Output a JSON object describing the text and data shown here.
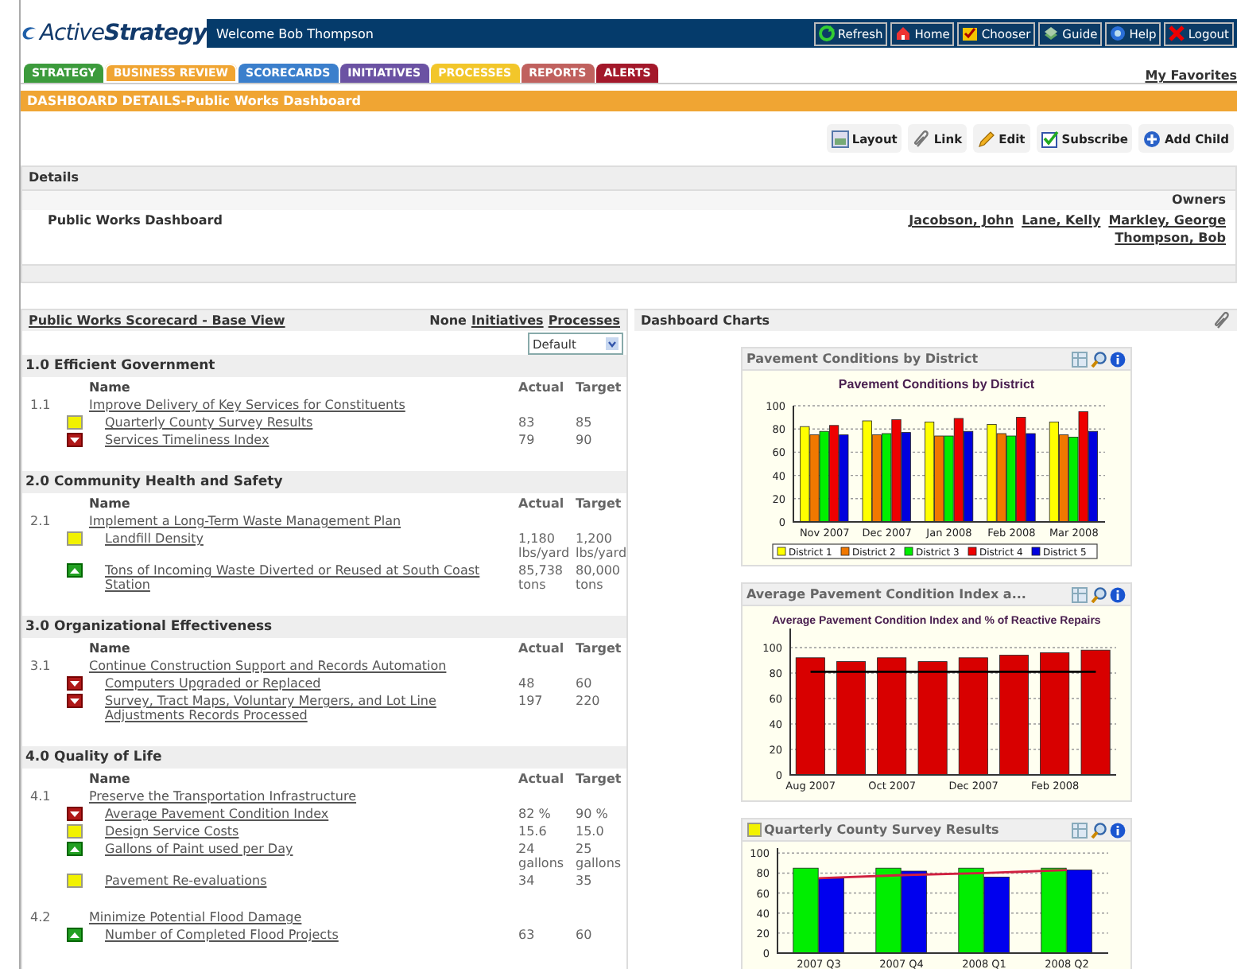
{
  "header": {
    "logo": "Active**Strategy**",
    "welcome": "Welcome Bob Thompson",
    "buttons": [
      "Refresh",
      "Home",
      "Chooser",
      "Guide",
      "Help",
      "Logout"
    ]
  },
  "tabs": [
    {
      "label": "STRATEGY",
      "color": "#3c9b3c",
      "selected": false
    },
    {
      "label": "BUSINESS REVIEW",
      "color": "#f0a533",
      "selected": true
    },
    {
      "label": "SCORECARDS",
      "color": "#3b7fcc",
      "selected": false
    },
    {
      "label": "INITIATIVES",
      "color": "#6b52a3",
      "selected": false
    },
    {
      "label": "PROCESSES",
      "color": "#f2c62a",
      "selected": false
    },
    {
      "label": "REPORTS",
      "color": "#c0615e",
      "selected": false
    },
    {
      "label": "ALERTS",
      "color": "#a3182a",
      "selected": false
    }
  ],
  "my_favorites": "My Favorites",
  "page_title": "DASHBOARD DETAILS-Public Works Dashboard",
  "toolbar": [
    "Layout",
    "Link",
    "Edit",
    "Subscribe",
    "Add Child"
  ],
  "details": {
    "title": "Details",
    "owners_label": "Owners",
    "name": "Public Works Dashboard",
    "owners": [
      "Jacobson, John",
      "Lane, Kelly",
      "Markley, George",
      "Thompson, Bob"
    ]
  },
  "scorecard": {
    "title": "Public Works Scorecard - Base View",
    "filter": "None",
    "links": [
      "Initiatives",
      "Processes"
    ],
    "view": "Default",
    "sections": [
      {
        "title": "1.0 Efficient Government",
        "columns": [
          "Name",
          "Actual",
          "Target"
        ],
        "objectives": [
          {
            "number": "1.1",
            "name": "Improve Delivery of Key Services for Constituents",
            "measures": [
              {
                "kind": "warning",
                "name": "Quarterly County Survey Results",
                "actual": "83",
                "target": "85"
              },
              {
                "kind": "below",
                "name": "Services Timeliness Index",
                "actual": "79",
                "target": "90"
              }
            ]
          }
        ]
      },
      {
        "title": "2.0 Community Health and Safety",
        "columns": [
          "Name",
          "Actual",
          "Target"
        ],
        "objectives": [
          {
            "number": "2.1",
            "name": "Implement a Long-Term Waste Management Plan",
            "measures": [
              {
                "kind": "warning",
                "name": "Landfill Density",
                "actual": "1,180 lbs/yard",
                "target": "1,200 lbs/yard"
              },
              {
                "kind": "above",
                "name": "Tons of Incoming Waste Diverted or Reused at South Coast Station",
                "actual": "85,738 tons",
                "target": "80,000 tons"
              }
            ]
          }
        ]
      },
      {
        "title": "3.0 Organizational Effectiveness",
        "columns": [
          "Name",
          "Actual",
          "Target"
        ],
        "objectives": [
          {
            "number": "3.1",
            "name": "Continue Construction Support and Records Automation",
            "measures": [
              {
                "kind": "below",
                "name": "Computers Upgraded or Replaced",
                "actual": "48",
                "target": "60"
              },
              {
                "kind": "below",
                "name": "Survey, Tract Maps, Voluntary Mergers, and Lot Line Adjustments Records Processed",
                "actual": "197",
                "target": "220"
              }
            ]
          }
        ]
      },
      {
        "title": "4.0 Quality of Life",
        "columns": [
          "Name",
          "Actual",
          "Target"
        ],
        "objectives": [
          {
            "number": "4.1",
            "name": "Preserve the Transportation Infrastructure",
            "measures": [
              {
                "kind": "below",
                "name": "Average Pavement Condition Index",
                "actual": "82 %",
                "target": "90 %"
              },
              {
                "kind": "warning",
                "name": "Design Service Costs",
                "actual": "15.6",
                "target": "15.0"
              },
              {
                "kind": "above",
                "name": "Gallons of Paint used per Day",
                "actual": "24 gallons",
                "target": "25 gallons"
              },
              {
                "kind": "warning",
                "name": "Pavement Re-evaluations",
                "actual": "34",
                "target": "35"
              }
            ]
          },
          {
            "number": "4.2",
            "name": "Minimize Potential Flood Damage",
            "measures": [
              {
                "kind": "above",
                "name": "Number of Completed Flood Projects",
                "actual": "63",
                "target": "60"
              }
            ]
          }
        ]
      }
    ]
  },
  "charts_panel": {
    "title": "Dashboard Charts",
    "charts": [
      {
        "title": "Pavement Conditions by District",
        "flag": false,
        "chart_data": {
          "type": "bar",
          "title": "Pavement Conditions by District",
          "categories": [
            "Nov 2007",
            "Dec 2007",
            "Jan 2008",
            "Feb 2008",
            "Mar 2008"
          ],
          "ylim": [
            0,
            100
          ],
          "yticks": [
            0,
            20,
            40,
            60,
            80,
            100
          ],
          "stacked": false,
          "grid": true,
          "legend": true,
          "series": [
            {
              "name": "District 1",
              "color": "#ffff00",
              "values": [
                82,
                87,
                86,
                84,
                86
              ]
            },
            {
              "name": "District 2",
              "color": "#f07800",
              "values": [
                75,
                75,
                74,
                76,
                75
              ]
            },
            {
              "name": "District 3",
              "color": "#00ee00",
              "values": [
                78,
                76,
                74,
                74,
                73
              ]
            },
            {
              "name": "District 4",
              "color": "#ee0000",
              "values": [
                83,
                88,
                89,
                90,
                95
              ]
            },
            {
              "name": "District 5",
              "color": "#0000dd",
              "values": [
                75,
                77,
                78,
                76,
                78
              ]
            }
          ]
        }
      },
      {
        "title": "Average Pavement Condition Index a...",
        "flag": false,
        "chart_data": {
          "type": "bar",
          "title": "Average Pavement Condition Index and % of Reactive Repairs",
          "categories": [
            "Aug 2007",
            null,
            "Oct 2007",
            null,
            "Dec 2007",
            null,
            "Feb 2008",
            null
          ],
          "ylim": [
            0,
            115
          ],
          "yticks": [
            0,
            20,
            40,
            60,
            80,
            100
          ],
          "stacked": false,
          "grid": true,
          "series": [
            {
              "type": "bar",
              "color": "#d80000",
              "values": [
                92,
                89,
                92,
                89,
                92,
                94,
                96,
                98
              ]
            },
            {
              "type": "line",
              "color": "#000000",
              "values": [
                81,
                81,
                81,
                81,
                81,
                81,
                81,
                81
              ]
            }
          ]
        }
      },
      {
        "title": "Quarterly County Survey Results",
        "flag": true,
        "chart_data": {
          "type": "bar",
          "categories": [
            "2007 Q3",
            "2007 Q4",
            "2008 Q1",
            "2008 Q2"
          ],
          "ylim": [
            0,
            105
          ],
          "yticks": [
            0,
            20,
            40,
            60,
            80,
            100
          ],
          "stacked": false,
          "grid": true,
          "series": [
            {
              "type": "bar",
              "color": "#00ee00",
              "values": [
                85,
                85,
                85,
                85
              ]
            },
            {
              "type": "bar",
              "color": "#0000ee",
              "values": [
                75,
                82,
                76,
                83
              ]
            },
            {
              "type": "line",
              "color": "#d02040",
              "values": [
                75,
                78,
                80,
                83
              ]
            }
          ]
        }
      }
    ]
  }
}
